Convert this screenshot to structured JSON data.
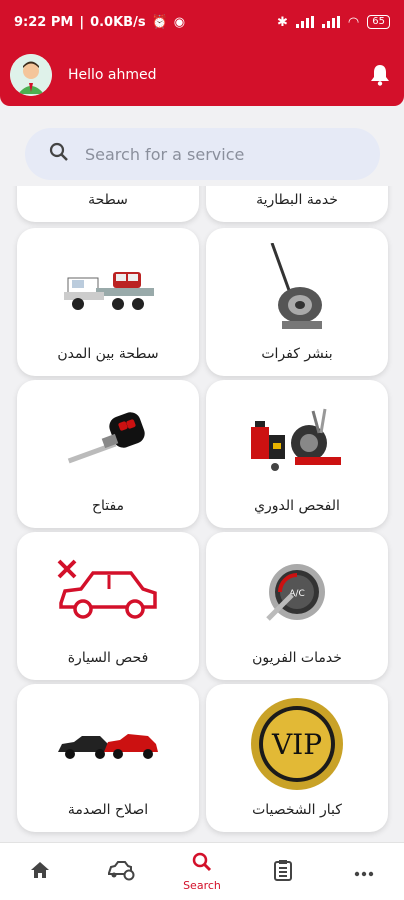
{
  "status_bar": {
    "time": "9:22 PM",
    "speed": "0.0KB/s",
    "battery": "65"
  },
  "header": {
    "greeting": "Hello ahmed"
  },
  "search": {
    "placeholder": "Search for a service"
  },
  "services": [
    {
      "label": "سطحة",
      "icon": "tow-truck-icon"
    },
    {
      "label": "خدمة البطارية",
      "icon": "battery-service-icon"
    },
    {
      "label": "سطحة بين المدن",
      "icon": "flatbed-truck-icon"
    },
    {
      "label": "بنشر كفرات",
      "icon": "tire-changer-icon"
    },
    {
      "label": "مفتاح",
      "icon": "car-key-icon"
    },
    {
      "label": "الفحص الدوري",
      "icon": "maintenance-tools-icon"
    },
    {
      "label": "فحص السيارة",
      "icon": "car-inspection-icon"
    },
    {
      "label": "خدمات الفريون",
      "icon": "ac-gauge-icon"
    },
    {
      "label": "اصلاح الصدمة",
      "icon": "crashed-cars-icon"
    },
    {
      "label": "كبار الشخصيات",
      "icon": "vip-badge-icon"
    }
  ],
  "bottom_nav": {
    "active_label": "Search",
    "items": [
      "home-icon",
      "car-settings-icon",
      "search-icon",
      "orders-icon",
      "more-icon"
    ]
  },
  "colors": {
    "primary": "#d3102a",
    "search_bg": "#e6eaf6"
  }
}
